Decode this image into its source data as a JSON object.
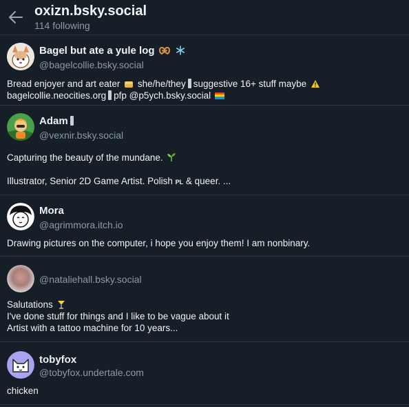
{
  "header": {
    "title": "oxizn.bsky.social",
    "subtitle": "114 following"
  },
  "users": [
    {
      "name": "Bagel but ate a yule log",
      "handle": "@bagelcollie.bsky.social",
      "bio1_a": "Bread enjoyer and art eater",
      "bio1_b": "she/he/they",
      "bio1_c": "suggestive 16+ stuff maybe",
      "bio2_a": "bagelcollie.neocities.org",
      "bio2_b": "pfp @p5ych.bsky.social"
    },
    {
      "name": "Adam",
      "handle": "@vexnir.bsky.social",
      "bio1": "Capturing the beauty of the mundane.",
      "bio2_a": "Illustrator, Senior 2D Game Artist. Polish",
      "bio2_flag": "PL",
      "bio2_b": "& queer. ..."
    },
    {
      "name": "Mora",
      "handle": "@agrimmora.itch.io",
      "bio1": "Drawing pictures on the computer, i hope you enjoy them! I am nonbinary."
    },
    {
      "name": "",
      "handle": "@nataliehall.bsky.social",
      "bio1": "Salutations",
      "bio2": "I've done stuff for things and I like to be vague about it",
      "bio3": "Artist with a tattoo machine for 10 years..."
    },
    {
      "name": "tobyfox",
      "handle": "@tobyfox.undertale.com",
      "bio1": "chicken"
    }
  ],
  "icons": {
    "back": "arrow-left-icon",
    "pretzel": "pretzel-icon",
    "snowflake": "snowflake-icon",
    "bread": "bread-icon",
    "warning": "warning-icon",
    "rainbow": "rainbow-flag-icon",
    "seedling": "seedling-icon",
    "cocktail": "cocktail-icon"
  },
  "colors": {
    "background": "#161e27",
    "divider": "#2a3541",
    "text": "#f1f3f5",
    "muted": "#8d9aa9"
  }
}
